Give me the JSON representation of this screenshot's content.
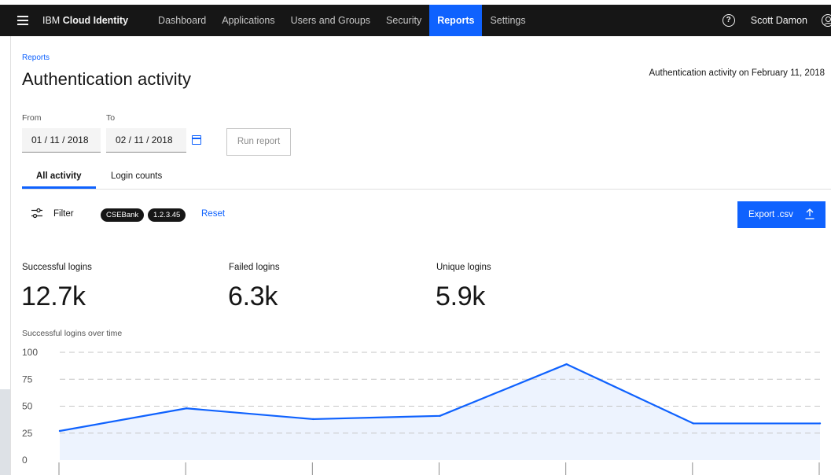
{
  "topnav": {
    "brand_prefix": "IBM",
    "brand_name": "Cloud Identity",
    "items": [
      {
        "label": "Dashboard",
        "active": false
      },
      {
        "label": "Applications",
        "active": false
      },
      {
        "label": "Users and Groups",
        "active": false
      },
      {
        "label": "Security",
        "active": false
      },
      {
        "label": "Reports",
        "active": true
      },
      {
        "label": "Settings",
        "active": false
      }
    ],
    "help_icon": "?",
    "user_name": "Scott Damon"
  },
  "header": {
    "breadcrumb": "Reports",
    "title": "Authentication activity",
    "activity_date": "Authentication activity on February 11, 2018"
  },
  "date_range": {
    "from_label": "From",
    "from_value": "01 / 11 / 2018",
    "to_label": "To",
    "to_value": "02 / 11 / 2018",
    "run_label": "Run report"
  },
  "tabs": [
    {
      "label": "All activity",
      "active": true
    },
    {
      "label": "Login counts",
      "active": false
    }
  ],
  "filter": {
    "label": "Filter",
    "tags": [
      "CSEBank",
      "1.2.3.45"
    ],
    "reset_label": "Reset",
    "export_label": "Export .csv"
  },
  "kpis": [
    {
      "label": "Successful logins",
      "value": "12.7k"
    },
    {
      "label": "Failed logins",
      "value": "6.3k"
    },
    {
      "label": "Unique logins",
      "value": "5.9k"
    }
  ],
  "chart_title": "Successful logins over time",
  "chart_data": {
    "type": "area",
    "y_ticks": [
      100,
      75,
      50,
      25,
      0
    ],
    "ylim": [
      0,
      100
    ],
    "x": [
      0,
      1,
      2,
      3,
      4,
      5,
      6
    ],
    "values": [
      27,
      48,
      38,
      41,
      89,
      34,
      34
    ],
    "grid": "horizontal-dashed",
    "colors": {
      "line": "#0f62fe",
      "fill": "#edf3fe",
      "grid": "#c6c6c6"
    }
  },
  "colors": {
    "accent": "#0f62fe",
    "nav_bg": "#161616"
  }
}
